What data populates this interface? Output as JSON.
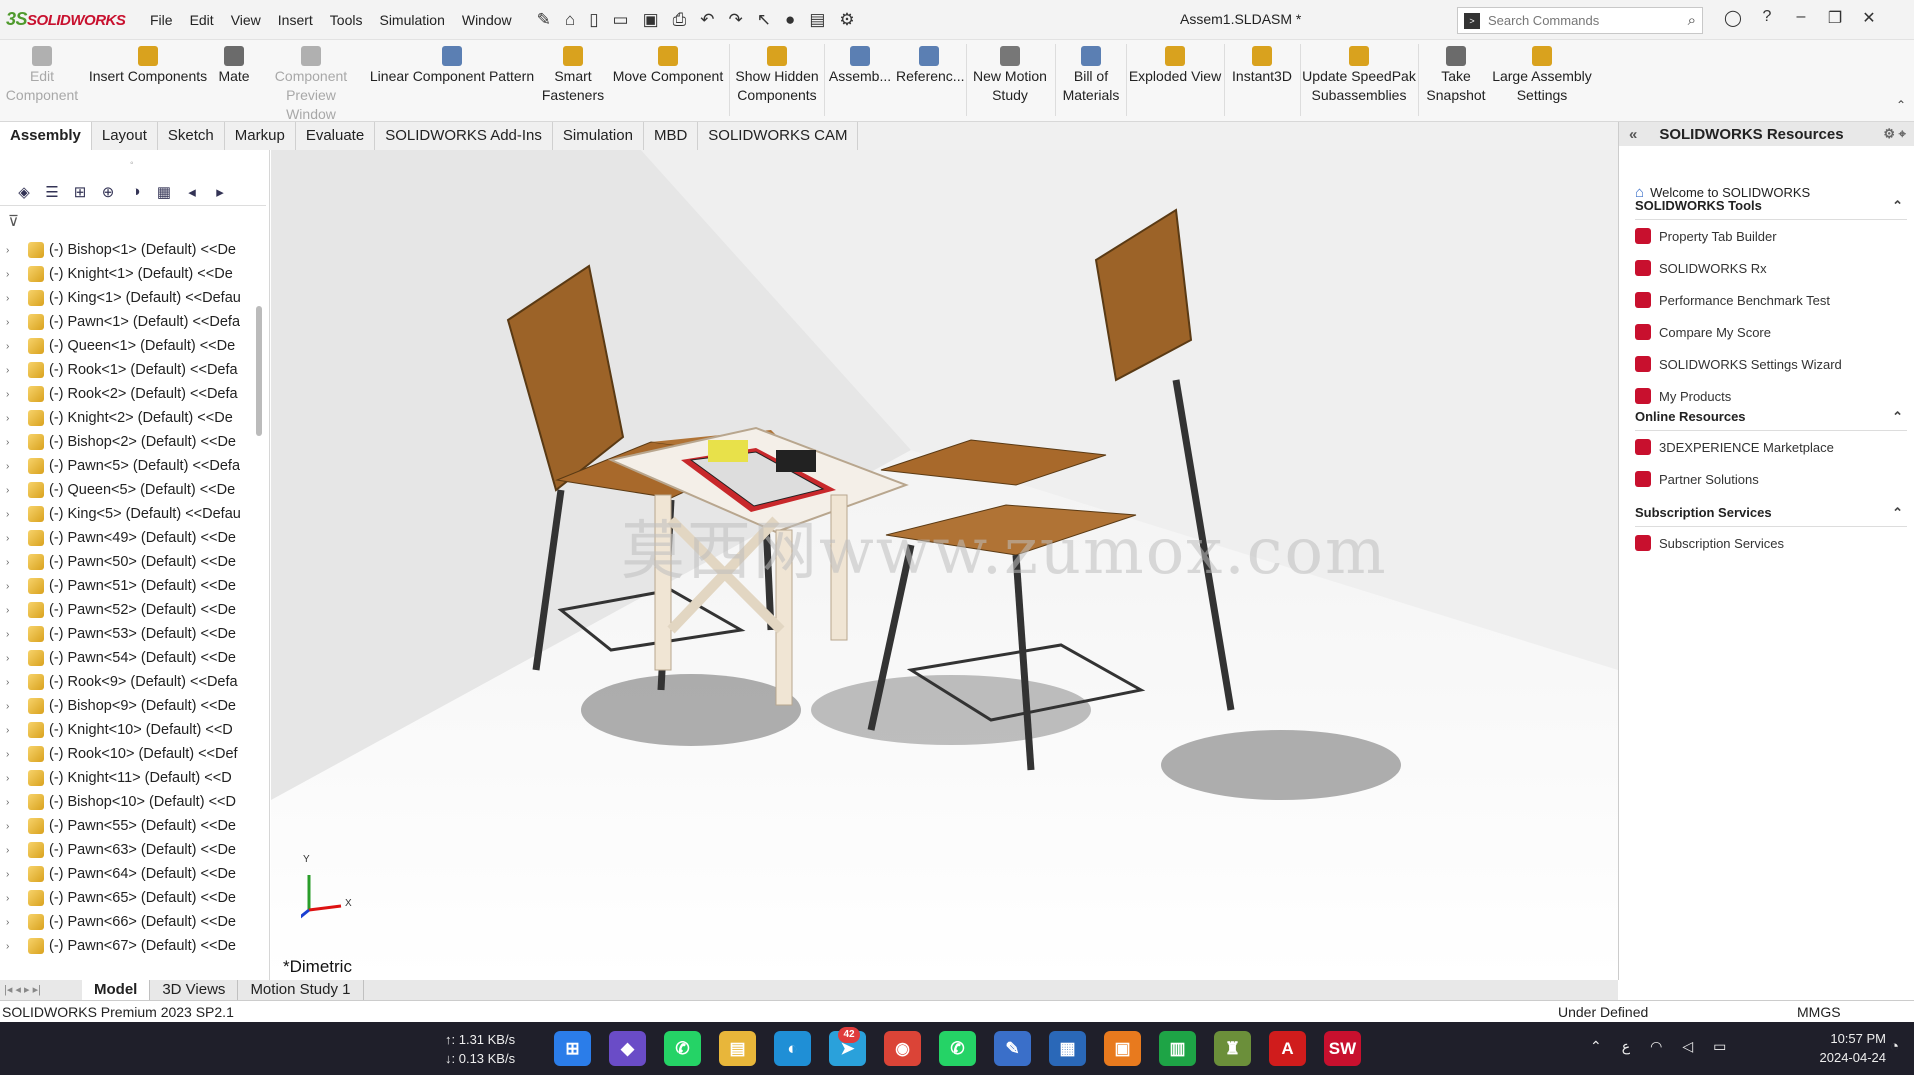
{
  "app": {
    "logo_prefix": "3S",
    "logo_text": "SOLIDWORKS",
    "document_title": "Assem1.SLDASM *"
  },
  "menu": [
    "File",
    "Edit",
    "View",
    "Insert",
    "Tools",
    "Simulation",
    "Window"
  ],
  "quick_access_icons": [
    "pin-icon",
    "home-icon",
    "new-doc-icon",
    "open-icon",
    "save-icon",
    "print-icon",
    "undo-icon",
    "redo-icon",
    "select-icon",
    "traffic-light-icon",
    "file-properties-icon",
    "options-icon"
  ],
  "search": {
    "placeholder": "Search Commands"
  },
  "ribbon": [
    {
      "label": "Edit Component",
      "disabled": true,
      "color": "#b0b0b0"
    },
    {
      "label": "Insert Components",
      "disabled": false,
      "color": "#d9a21e"
    },
    {
      "label": "Mate",
      "disabled": false,
      "color": "#6b6b6b"
    },
    {
      "label": "Component Preview Window",
      "disabled": true,
      "color": "#b0b0b0"
    },
    {
      "label": "Linear Component Pattern",
      "disabled": false,
      "color": "#5b7fb3"
    },
    {
      "label": "Smart Fasteners",
      "disabled": false,
      "color": "#d9a21e"
    },
    {
      "label": "Move Component",
      "disabled": false,
      "color": "#d9a21e"
    },
    {
      "label": "Show Hidden Components",
      "disabled": false,
      "color": "#d9a21e"
    },
    {
      "label": "Assemb...",
      "disabled": false,
      "color": "#5b7fb3"
    },
    {
      "label": "Referenc...",
      "disabled": false,
      "color": "#5b7fb3"
    },
    {
      "label": "New Motion Study",
      "disabled": false,
      "color": "#777777"
    },
    {
      "label": "Bill of Materials",
      "disabled": false,
      "color": "#5b7fb3"
    },
    {
      "label": "Exploded View",
      "disabled": false,
      "color": "#d9a21e"
    },
    {
      "label": "Instant3D",
      "disabled": false,
      "color": "#d9a21e"
    },
    {
      "label": "Update SpeedPak Subassemblies",
      "disabled": false,
      "color": "#d9a21e"
    },
    {
      "label": "Take Snapshot",
      "disabled": false,
      "color": "#6b6b6b"
    },
    {
      "label": "Large Assembly Settings",
      "disabled": false,
      "color": "#d9a21e"
    }
  ],
  "command_tabs": [
    {
      "label": "Assembly",
      "active": true
    },
    {
      "label": "Layout"
    },
    {
      "label": "Sketch"
    },
    {
      "label": "Markup"
    },
    {
      "label": "Evaluate"
    },
    {
      "label": "SOLIDWORKS Add-Ins"
    },
    {
      "label": "Simulation"
    },
    {
      "label": "MBD"
    },
    {
      "label": "SOLIDWORKS CAM"
    }
  ],
  "tree": [
    "(-) Bishop<1> (Default) <<De",
    "(-) Knight<1> (Default) <<De",
    "(-) King<1> (Default) <<Defau",
    "(-) Pawn<1> (Default) <<Defa",
    "(-) Queen<1> (Default) <<De",
    "(-) Rook<1> (Default) <<Defa",
    "(-) Rook<2> (Default) <<Defa",
    "(-) Knight<2> (Default) <<De",
    "(-) Bishop<2> (Default) <<De",
    "(-) Pawn<5> (Default) <<Defa",
    "(-) Queen<5> (Default) <<De",
    "(-) King<5> (Default) <<Defau",
    "(-) Pawn<49> (Default) <<De",
    "(-) Pawn<50> (Default) <<De",
    "(-) Pawn<51> (Default) <<De",
    "(-) Pawn<52> (Default) <<De",
    "(-) Pawn<53> (Default) <<De",
    "(-) Pawn<54> (Default) <<De",
    "(-) Rook<9> (Default) <<Defa",
    "(-) Bishop<9> (Default) <<De",
    "(-) Knight<10> (Default) <<D",
    "(-) Rook<10> (Default) <<Def",
    "(-) Knight<11> (Default) <<D",
    "(-) Bishop<10> (Default) <<D",
    "(-) Pawn<55> (Default) <<De",
    "(-) Pawn<63> (Default) <<De",
    "(-) Pawn<64> (Default) <<De",
    "(-) Pawn<65> (Default) <<De",
    "(-) Pawn<66> (Default) <<De",
    "(-) Pawn<67> (Default) <<De"
  ],
  "viewport": {
    "view_label": "*Dimetric",
    "watermark": "莫西网www.zumox.com",
    "axis_x": "X",
    "axis_y": "Y"
  },
  "resources": {
    "title": "SOLIDWORKS Resources",
    "welcome": "Welcome to SOLIDWORKS",
    "sections": [
      {
        "title": "SOLIDWORKS Tools",
        "items": [
          "Property Tab Builder",
          "SOLIDWORKS Rx",
          "Performance Benchmark Test",
          "Compare My Score",
          "SOLIDWORKS Settings Wizard",
          "My Products"
        ]
      },
      {
        "title": "Online Resources",
        "items": [
          "3DEXPERIENCE Marketplace",
          "Partner Solutions"
        ]
      },
      {
        "title": "Subscription Services",
        "items": [
          "Subscription Services"
        ]
      }
    ]
  },
  "bottom_tabs": [
    {
      "label": "Model",
      "active": true
    },
    {
      "label": "3D Views"
    },
    {
      "label": "Motion Study 1"
    }
  ],
  "status": {
    "product": "SOLIDWORKS Premium 2023 SP2.1",
    "state": "Under Defined",
    "units": "MMGS"
  },
  "taskbar": {
    "upload": "↑: 1.31 KB/s",
    "download": "↓: 0.13 KB/s",
    "apps": [
      {
        "name": "windows-start",
        "glyph": "⊞",
        "color": "#2b7de9"
      },
      {
        "name": "copilot",
        "glyph": "◆",
        "color": "#6a4cc7"
      },
      {
        "name": "whatsapp",
        "glyph": "✆",
        "color": "#25d366"
      },
      {
        "name": "file-explorer",
        "glyph": "▤",
        "color": "#e8b63a"
      },
      {
        "name": "edge",
        "glyph": "◐",
        "color": "#1f8fd6"
      },
      {
        "name": "telegram",
        "glyph": "➤",
        "color": "#2aa1db",
        "badge": "42"
      },
      {
        "name": "chrome",
        "glyph": "◉",
        "color": "#db4437"
      },
      {
        "name": "whatsapp-2",
        "glyph": "✆",
        "color": "#25d366"
      },
      {
        "name": "pen-app",
        "glyph": "✎",
        "color": "#3a6fc9"
      },
      {
        "name": "calendar-app",
        "glyph": "▦",
        "color": "#2a68b8"
      },
      {
        "name": "orange-app",
        "glyph": "▣",
        "color": "#e87a1e"
      },
      {
        "name": "green-app",
        "glyph": "▥",
        "color": "#1ea446"
      },
      {
        "name": "assembly-app",
        "glyph": "♜",
        "color": "#6b8f3a"
      },
      {
        "name": "acrobat",
        "glyph": "A",
        "color": "#d01c1c"
      },
      {
        "name": "solidworks",
        "glyph": "SW",
        "color": "#c8102e"
      }
    ],
    "time": "10:57 PM",
    "date": "2024-04-24"
  }
}
